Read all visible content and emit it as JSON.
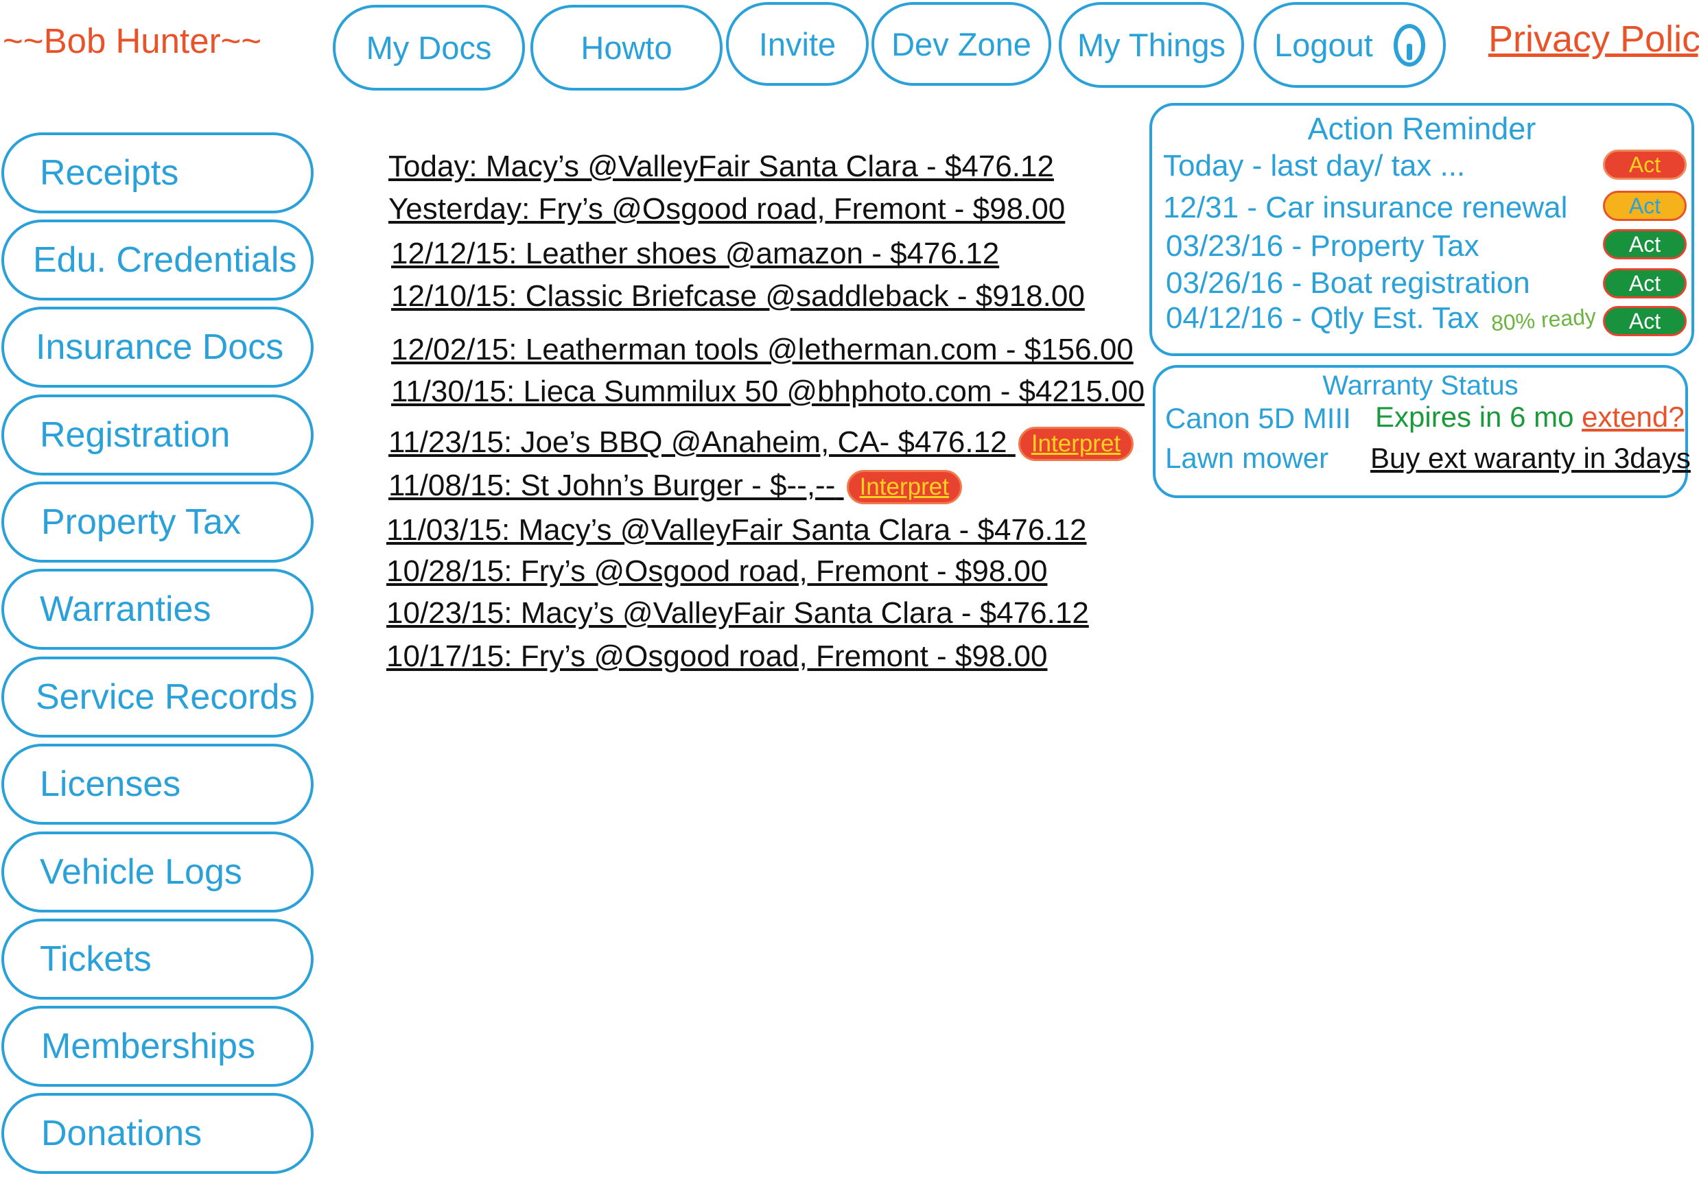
{
  "header": {
    "user_name": "~~Bob Hunter~~",
    "nav": [
      "My Docs",
      "Howto",
      "Invite",
      "Dev Zone",
      "My Things",
      "Logout"
    ],
    "privacy": "Privacy Policy"
  },
  "sidebar": {
    "items": [
      "Receipts",
      "Edu. Credentials",
      "Insurance Docs",
      "Registration",
      "Property Tax",
      "Warranties",
      "Service Records",
      "Licenses",
      "Vehicle Logs",
      "Tickets",
      "Memberships",
      "Donations"
    ]
  },
  "receipts": [
    {
      "text": "Today: Macy’s @ValleyFair Santa Clara - $476.12"
    },
    {
      "text": "Yesterday: Fry’s @Osgood road, Fremont - $98.00"
    },
    {
      "text": "12/12/15: Leather shoes @amazon - $476.12"
    },
    {
      "text": "12/10/15: Classic Briefcase @saddleback - $918.00"
    },
    {
      "text": "12/02/15: Leatherman tools @letherman.com - $156.00"
    },
    {
      "text": "11/30/15: Lieca Summilux 50 @bhphoto.com - $4215.00"
    },
    {
      "text": "11/23/15: Joe’s BBQ @Anaheim, CA- $476.12",
      "action": "Interpret"
    },
    {
      "text": "11/08/15: St John’s Burger - $--,--",
      "action": "Interpret"
    },
    {
      "text": "11/03/15: Macy’s @ValleyFair Santa Clara - $476.12"
    },
    {
      "text": "10/28/15: Fry’s @Osgood road, Fremont - $98.00"
    },
    {
      "text": "10/23/15: Macy’s @ValleyFair Santa Clara - $476.12"
    },
    {
      "text": "10/17/15: Fry’s @Osgood road, Fremont - $98.00"
    }
  ],
  "reminder": {
    "title": "Action Reminder",
    "items": [
      {
        "text": "Today - last day/ tax ...",
        "action": "Act",
        "status": "urgent",
        "color": "#e8432e"
      },
      {
        "text": "12/31 - Car insurance renewal",
        "action": "Act",
        "status": "warning",
        "color": "#f6b21b"
      },
      {
        "text": "03/23/16 - Property Tax",
        "action": "Act",
        "status": "ok",
        "color": "#18923c"
      },
      {
        "text": "03/26/16 - Boat registration",
        "action": "Act",
        "status": "ok",
        "color": "#18923c"
      },
      {
        "text": "04/12/16 - Qtly Est. Tax",
        "action": "Act",
        "status": "ok",
        "color": "#18923c",
        "note": "80% ready"
      }
    ]
  },
  "warranty": {
    "title": "Warranty Status",
    "items": [
      {
        "name": "Canon 5D MIII",
        "status": "Expires in 6 mo",
        "link": "extend?"
      },
      {
        "name": "Lawn mower",
        "status": "Buy ext waranty in 3days"
      }
    ]
  },
  "colors": {
    "accent": "#2aa1d8",
    "brand": "#e8532a",
    "act_red": "#e8432e",
    "act_yellow": "#f6b21b",
    "act_green": "#18923c",
    "interpret_text": "#ffd21f",
    "ready_green": "#6cb33f"
  }
}
